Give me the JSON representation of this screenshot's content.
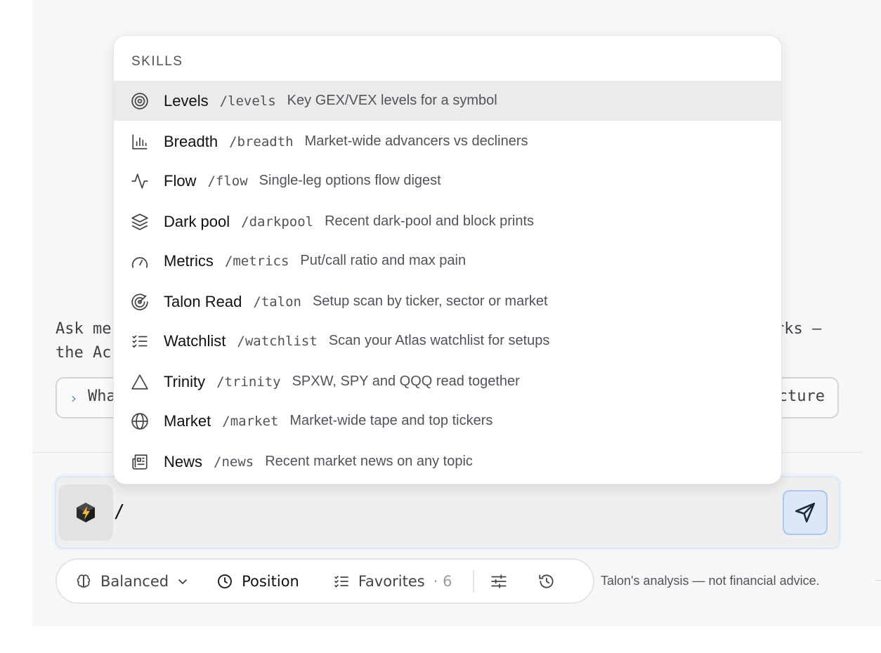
{
  "background_text": {
    "intro_line1_left": "Ask me",
    "intro_line1_right": "rks —",
    "intro_line2_left": "the Ac",
    "suggestion_left": "Wha",
    "suggestion_right": "cture"
  },
  "skills_menu": {
    "heading": "SKILLS",
    "items": [
      {
        "name": "Levels",
        "command": "/levels",
        "description": "Key GEX/VEX levels for a symbol",
        "icon": "target-icon",
        "active": true
      },
      {
        "name": "Breadth",
        "command": "/breadth",
        "description": "Market-wide advancers vs decliners",
        "icon": "bar-chart-icon",
        "active": false
      },
      {
        "name": "Flow",
        "command": "/flow",
        "description": "Single-leg options flow digest",
        "icon": "activity-icon",
        "active": false
      },
      {
        "name": "Dark pool",
        "command": "/darkpool",
        "description": "Recent dark-pool and block prints",
        "icon": "layers-icon",
        "active": false
      },
      {
        "name": "Metrics",
        "command": "/metrics",
        "description": "Put/call ratio and max pain",
        "icon": "gauge-icon",
        "active": false
      },
      {
        "name": "Talon Read",
        "command": "/talon",
        "description": "Setup scan by ticker, sector or market",
        "icon": "radar-icon",
        "active": false
      },
      {
        "name": "Watchlist",
        "command": "/watchlist",
        "description": "Scan your Atlas watchlist for setups",
        "icon": "checklist-icon",
        "active": false
      },
      {
        "name": "Trinity",
        "command": "/trinity",
        "description": "SPXW, SPY and QQQ read together",
        "icon": "triangle-icon",
        "active": false
      },
      {
        "name": "Market",
        "command": "/market",
        "description": "Market-wide tape and top tickers",
        "icon": "globe-icon",
        "active": false
      },
      {
        "name": "News",
        "command": "/news",
        "description": "Recent market news on any topic",
        "icon": "newspaper-icon",
        "active": false
      }
    ]
  },
  "composer": {
    "value": "/"
  },
  "toolbar": {
    "mode_label": "Balanced",
    "horizon_label": "Position",
    "favorites_label": "Favorites",
    "favorites_count": "· 6"
  },
  "disclaimer": "Talon's analysis — not financial advice.",
  "colors": {
    "accent": "#5b8def",
    "send_button_bg": "#dce8f8",
    "active_row": "#ebebec"
  }
}
